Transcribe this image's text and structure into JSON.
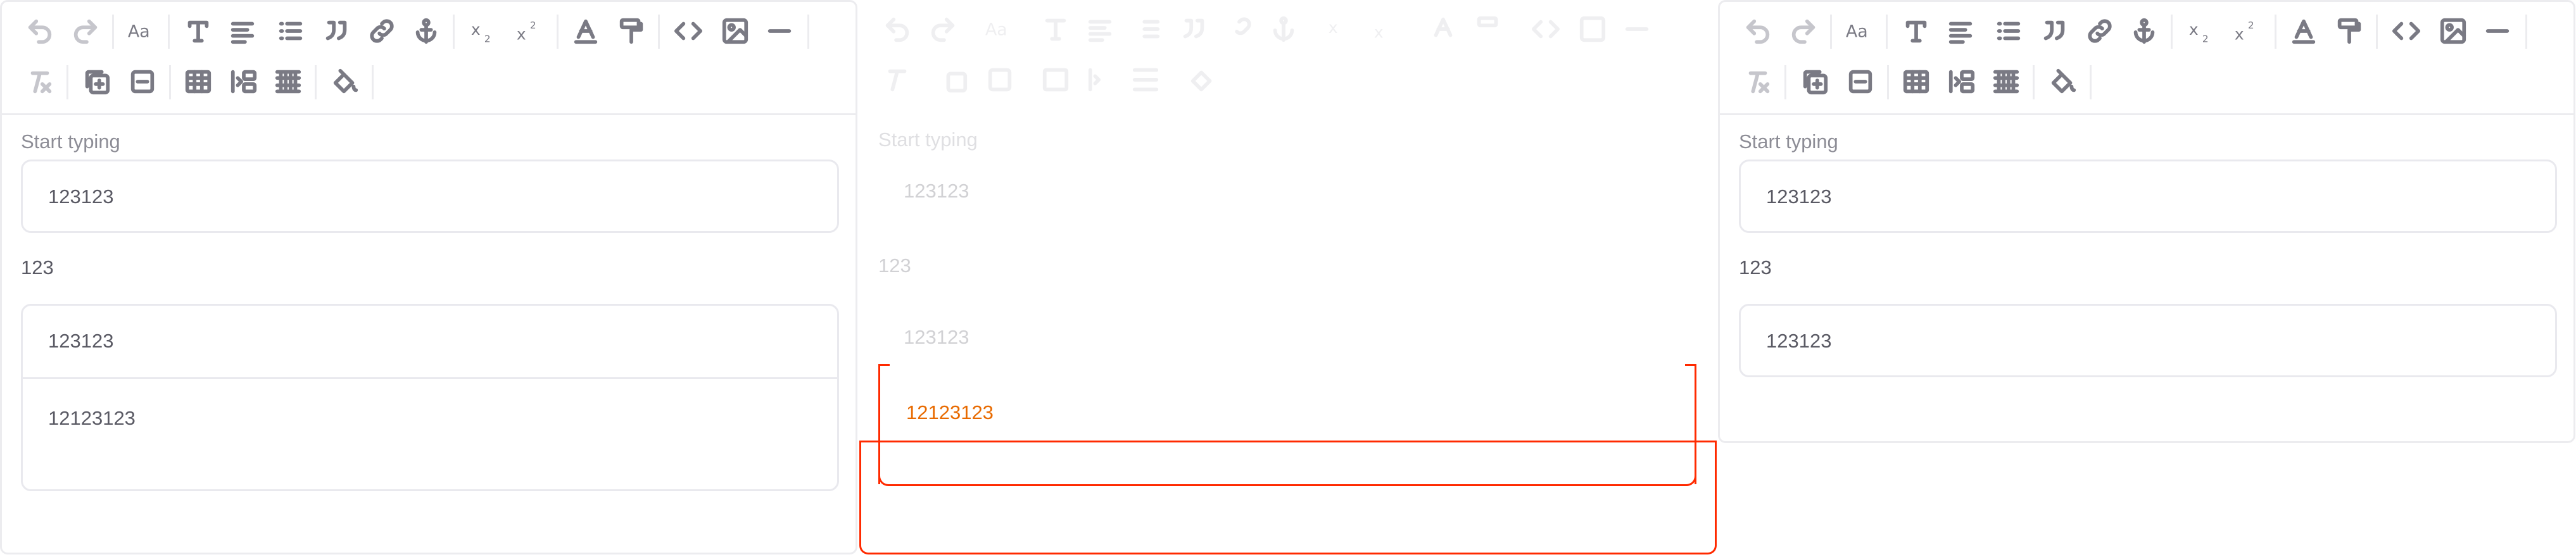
{
  "editor": {
    "placeholder": "Start typing",
    "first_block": "123123",
    "plain_line": "123",
    "table_cell_1": "123123",
    "table_cell_2": "12123123"
  },
  "drag_preview": {
    "text": "12123123",
    "accent_color": "#ff2a00",
    "text_color": "#e86a00"
  },
  "toolbar": {
    "row1": [
      "undo-icon",
      "redo-icon",
      "text-size-icon",
      "paragraph-icon",
      "align-icon",
      "list-icon",
      "quote-icon",
      "link-icon",
      "anchor-icon",
      "subscript-icon",
      "superscript-icon",
      "text-color-icon",
      "format-painter-icon",
      "code-icon",
      "image-icon",
      "horizontal-rule-icon"
    ],
    "row2": [
      "clear-format-icon",
      "insert-block-icon",
      "remove-block-icon",
      "table-icon",
      "indent-icon",
      "grid-icon",
      "fill-icon"
    ]
  }
}
